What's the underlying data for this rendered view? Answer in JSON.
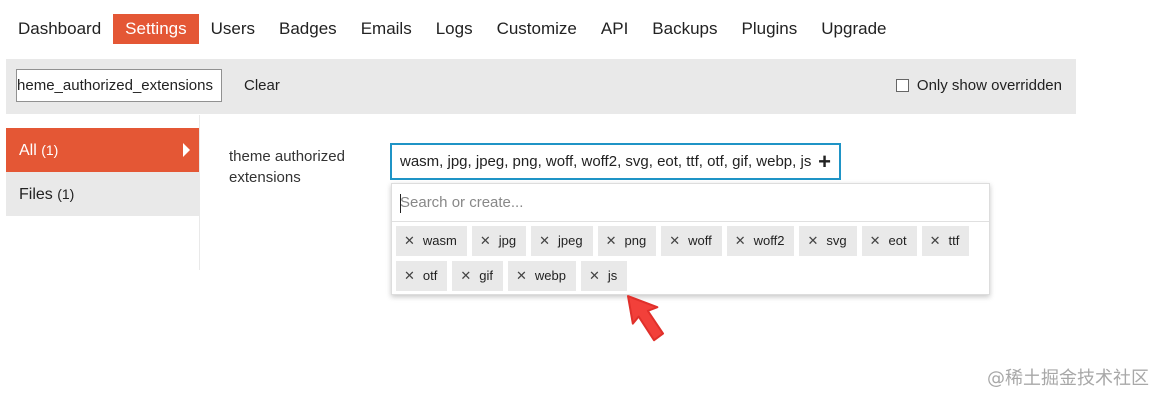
{
  "nav": {
    "items": [
      "Dashboard",
      "Settings",
      "Users",
      "Badges",
      "Emails",
      "Logs",
      "Customize",
      "API",
      "Backups",
      "Plugins",
      "Upgrade"
    ],
    "active": "Settings"
  },
  "filter": {
    "value": "theme_authorized_extensions",
    "clear_label": "Clear",
    "only_overridden_label": "Only show overridden"
  },
  "sidebar": {
    "all_label": "All",
    "all_count": "(1)",
    "files_label": "Files",
    "files_count": "(1)"
  },
  "setting": {
    "label": "theme authorized extensions",
    "value": "wasm, jpg, jpeg, png, woff, woff2, svg, eot, ttf, otf, gif, webp, js",
    "search_placeholder": "Search or create...",
    "chips": [
      "wasm",
      "jpg",
      "jpeg",
      "png",
      "woff",
      "woff2",
      "svg",
      "eot",
      "ttf",
      "otf",
      "gif",
      "webp",
      "js"
    ]
  },
  "icons": {
    "chip_remove": "x-icon",
    "add": "plus-icon",
    "pointer": "red-arrow-icon"
  },
  "colors": {
    "accent": "#e45735",
    "focus_border": "#1f94c6",
    "panel_bg": "#e9e9e9"
  },
  "watermark": "@稀土掘金技术社区"
}
